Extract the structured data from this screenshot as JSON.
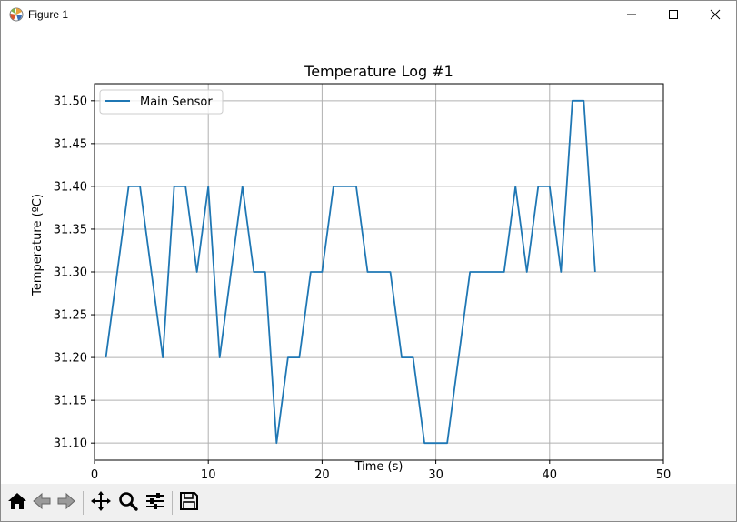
{
  "window": {
    "title": "Figure 1",
    "icons": [
      "matplotlib-logo-icon",
      "minimize-icon",
      "maximize-icon",
      "close-icon"
    ]
  },
  "toolbar": {
    "tools": [
      "home-icon",
      "back-icon",
      "forward-icon",
      "pan-icon",
      "zoom-icon",
      "configure-subplots-icon",
      "save-icon"
    ]
  },
  "chart_data": {
    "type": "line",
    "title": "Temperature Log #1",
    "xlabel": "Time (s)",
    "ylabel": "Temperature (ºC)",
    "xlim": [
      0,
      50
    ],
    "ylim": [
      31.08,
      31.52
    ],
    "xticks": [
      0,
      10,
      20,
      30,
      40,
      50
    ],
    "yticks": [
      31.1,
      31.15,
      31.2,
      31.25,
      31.3,
      31.35,
      31.4,
      31.45,
      31.5
    ],
    "xtick_labels": [
      "0",
      "10",
      "20",
      "30",
      "40",
      "50"
    ],
    "ytick_labels": [
      "31.10",
      "31.15",
      "31.20",
      "31.25",
      "31.30",
      "31.35",
      "31.40",
      "31.45",
      "31.50"
    ],
    "grid": true,
    "legend": "upper-left",
    "series": [
      {
        "name": "Main Sensor",
        "color": "#1f77b4",
        "x": [
          1,
          2,
          3,
          4,
          5,
          6,
          7,
          8,
          9,
          10,
          11,
          12,
          13,
          14,
          15,
          16,
          17,
          18,
          19,
          20,
          21,
          22,
          23,
          24,
          25,
          26,
          27,
          28,
          29,
          30,
          31,
          32,
          33,
          34,
          35,
          36,
          37,
          38,
          39,
          40,
          41,
          42,
          43,
          44
        ],
        "y": [
          31.2,
          31.3,
          31.4,
          31.4,
          31.3,
          31.2,
          31.4,
          31.4,
          31.3,
          31.4,
          31.2,
          31.3,
          31.4,
          31.3,
          31.3,
          31.1,
          31.2,
          31.2,
          31.3,
          31.3,
          31.4,
          31.4,
          31.4,
          31.3,
          31.3,
          31.3,
          31.2,
          31.2,
          31.1,
          31.1,
          31.1,
          31.2,
          31.3,
          31.3,
          31.3,
          31.3,
          31.4,
          31.3,
          31.4,
          31.4,
          31.3,
          31.5,
          31.5,
          31.3
        ]
      }
    ]
  }
}
